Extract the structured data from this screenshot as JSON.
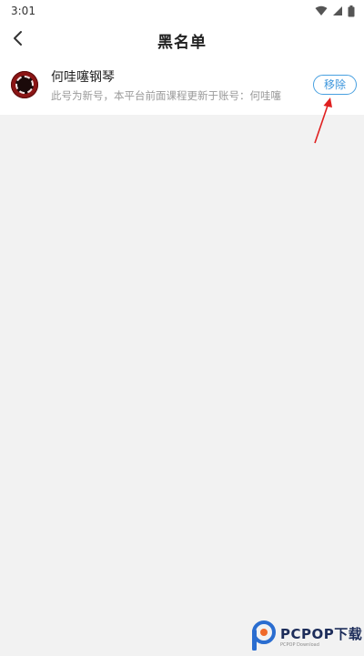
{
  "status_bar": {
    "time": "3:01",
    "icons": [
      "wifi-icon",
      "cellular-signal-icon",
      "battery-icon"
    ]
  },
  "app_bar": {
    "back_icon": "chevron-left-icon",
    "title": "黑名单"
  },
  "blacklist": [
    {
      "avatar": "avatar-icon",
      "name": "何哇噻钢琴",
      "description": "此号为新号，本平台前面课程更新于账号：何哇噻",
      "remove_label": "移除"
    }
  ],
  "annotation": {
    "arrow_color": "#e02020"
  },
  "watermark": {
    "brand": "PCPOP下载",
    "sub": "PCPOP Download"
  },
  "colors": {
    "accent": "#3b95dc",
    "background": "#f2f2f2"
  }
}
